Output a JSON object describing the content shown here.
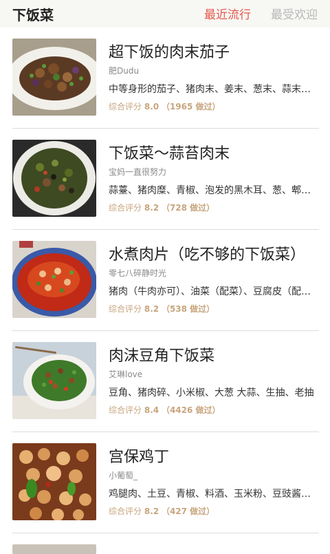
{
  "header": {
    "title": "下饭菜",
    "tabs": [
      {
        "label": "最近流行",
        "active": true
      },
      {
        "label": "最受欢迎",
        "active": false
      }
    ]
  },
  "colors": {
    "accent": "#e5574b",
    "rating": "#c8a57e",
    "inactive_tab": "#b7b7b7"
  },
  "recipes": [
    {
      "title": "超下饭的肉末茄子",
      "author": "肥Dudu",
      "ingredients": "中等身形的茄子、猪肉末、姜末、葱末、蒜末、豆瓣酱",
      "rating_label": "综合评分",
      "score": "8.0",
      "made": "（1965 做过）",
      "thumb": "eggplant-dish"
    },
    {
      "title": "下饭菜～蒜苔肉末",
      "author": "宝妈一直很努力",
      "ingredients": "蒜薹、猪肉糜、青椒、泡发的黑木耳、葱、郫县豆瓣酱",
      "rating_label": "综合评分",
      "score": "8.2",
      "made": "（728 做过）",
      "thumb": "garlic-stem-dish"
    },
    {
      "title": "水煮肉片（吃不够的下饭菜）",
      "author": "零七八碎静时光",
      "ingredients": "猪肉（牛肉亦可）、油菜（配菜）、豆腐皮（配菜）",
      "rating_label": "综合评分",
      "score": "8.2",
      "made": "（538 做过）",
      "thumb": "boiled-pork-dish"
    },
    {
      "title": "肉沫豆角下饭菜",
      "author": "艾琳love",
      "ingredients": "豆角、猪肉碎、小米椒、大葱 大蒜、生抽、老抽",
      "rating_label": "综合评分",
      "score": "8.4",
      "made": "（4426 做过）",
      "thumb": "green-bean-dish"
    },
    {
      "title": "宫保鸡丁",
      "author": "小葡萄_",
      "ingredients": "鸡腿肉、土豆、青椒、料酒、玉米粉、豆豉酱、花生",
      "rating_label": "综合评分",
      "score": "8.2",
      "made": "（427 做过）",
      "thumb": "kungpao-chicken-dish"
    }
  ]
}
